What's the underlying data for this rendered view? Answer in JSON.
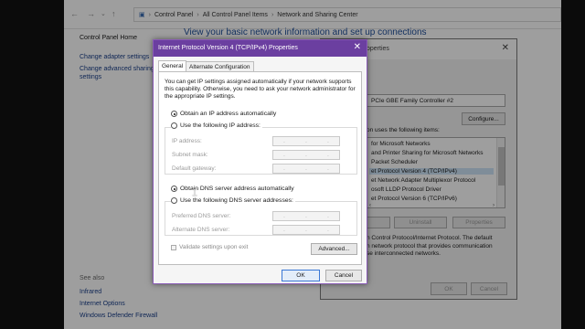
{
  "control_panel": {
    "breadcrumb": [
      "Control Panel",
      "All Control Panel Items",
      "Network and Sharing Center"
    ],
    "title": "View your basic network information and set up connections",
    "sidebar": {
      "home": "Control Panel Home",
      "links": [
        "Change adapter settings",
        "Change advanced sharing",
        "settings"
      ],
      "see_also_heading": "See also",
      "see_also": [
        "Infrared",
        "Internet Options",
        "Windows Defender Firewall"
      ]
    }
  },
  "ethernet_dialog": {
    "title_fragment": "operties",
    "adapter": "PCIe GBE Family Controller #2",
    "configure_label": "Configure...",
    "uses_label": "on uses the following items:",
    "items": [
      "for Microsoft Networks",
      "and Printer Sharing for Microsoft Networks",
      "Packet Scheduler",
      "et Protocol Version 4 (TCP/IPv4)",
      "et Network Adapter Multiplexor Protocol",
      "osoft LLDP Protocol Driver",
      "et Protocol Version 6 (TCP/IPv6)"
    ],
    "selected_index": 3,
    "install_label": "",
    "uninstall_label": "Uninstall",
    "properties_label": "Properties",
    "description": "n Control Protocol/Internet Protocol. The default\nn network protocol that provides communication\nse interconnected networks.",
    "ok_label": "OK",
    "cancel_label": "Cancel"
  },
  "ipv4_dialog": {
    "title": "Internet Protocol Version 4 (TCP/IPv4) Properties",
    "tabs": [
      "General",
      "Alternate Configuration"
    ],
    "active_tab": 0,
    "intro": "You can get IP settings assigned automatically if your network supports this capability. Otherwise, you need to ask your network administrator for the appropriate IP settings.",
    "ip_auto_label": "Obtain an IP address automatically",
    "ip_manual_label": "Use the following IP address:",
    "ip_fields": [
      "IP address:",
      "Subnet mask:",
      "Default gateway:"
    ],
    "dns_auto_label": "Obtain DNS server address automatically",
    "dns_manual_label": "Use the following DNS server addresses:",
    "dns_fields": [
      "Preferred DNS server:",
      "Alternate DNS server:"
    ],
    "ip_mode": "auto",
    "dns_mode": "auto",
    "validate_label": "Validate settings upon exit",
    "validate_checked": false,
    "advanced_label": "Advanced...",
    "ok_label": "OK",
    "cancel_label": "Cancel",
    "ip_placeholder_dots": ". . ."
  },
  "colors": {
    "title_bar": "#6b3fa0",
    "link": "#1a3f8a",
    "page_title": "#1e4e9a"
  }
}
